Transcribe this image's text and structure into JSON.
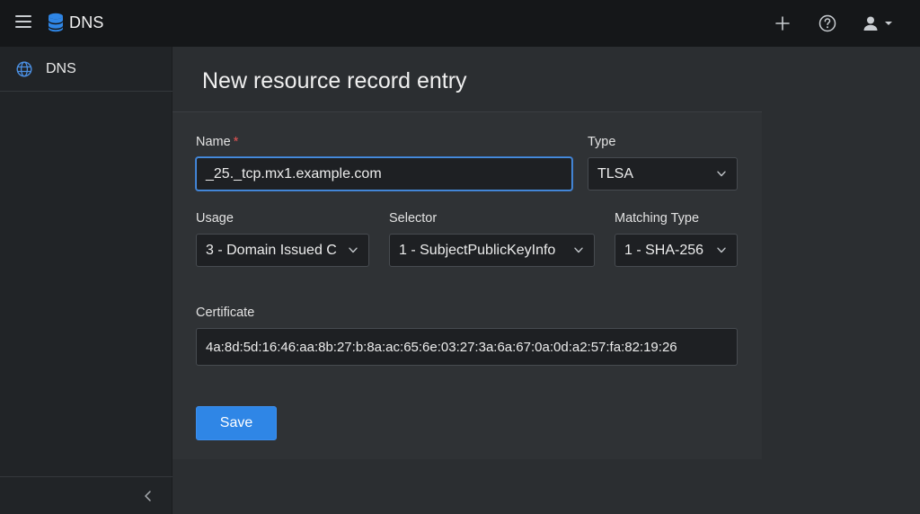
{
  "app": {
    "title": "DNS"
  },
  "header": {
    "icons": [
      "menu-icon",
      "database-icon",
      "plus-icon",
      "help-icon",
      "user-icon"
    ]
  },
  "sidebar": {
    "items": [
      {
        "label": "DNS",
        "icon": "globe-icon"
      }
    ],
    "collapse_icon": "chevron-left-icon"
  },
  "main": {
    "title": "New resource record entry",
    "form": {
      "name": {
        "label": "Name",
        "required_mark": "*",
        "value": "_25._tcp.mx1.example.com"
      },
      "type": {
        "label": "Type",
        "value": "TLSA"
      },
      "usage": {
        "label": "Usage",
        "value": "3 - Domain Issued C"
      },
      "selector": {
        "label": "Selector",
        "value": "1 - SubjectPublicKeyInfo"
      },
      "matching_type": {
        "label": "Matching Type",
        "value": "1 - SHA-256"
      },
      "certificate": {
        "label": "Certificate",
        "value": "4a:8d:5d:16:46:aa:8b:27:b:8a:ac:65:6e:03:27:3a:6a:67:0a:0d:a2:57:fa:82:19:26"
      },
      "save_label": "Save"
    }
  },
  "colors": {
    "topbar": "#151719",
    "sidebar": "#212427",
    "background": "#2b2e31",
    "card": "#2f3235",
    "accent": "#2f86e6",
    "focus": "#4a8fe0",
    "required": "#e35454"
  }
}
